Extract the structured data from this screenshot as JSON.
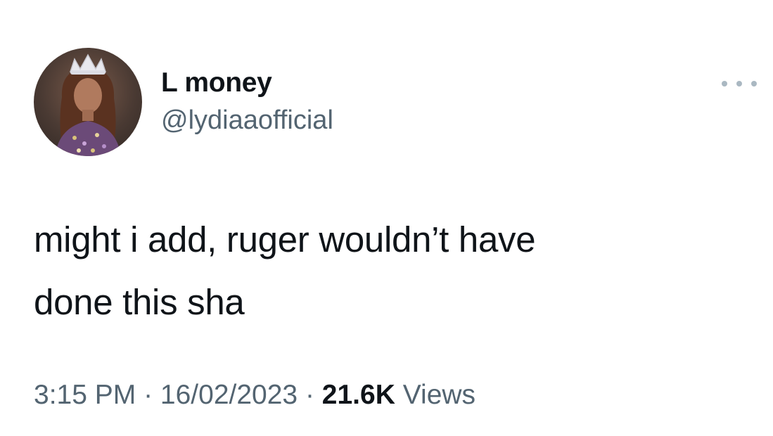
{
  "tweet": {
    "author": {
      "display_name": "L money",
      "handle": "@lydiaaofficial",
      "avatar": "profile-photo"
    },
    "more_icon": "more-horizontal-icon",
    "text_lines": [
      "might i add, ruger wouldn’t have",
      "done this sha"
    ],
    "meta": {
      "time": "3:15 PM",
      "separator": " · ",
      "date": "16/02/2023",
      "views_count": "21.6K",
      "views_label": "Views"
    }
  },
  "colors": {
    "primary_text": "#0f1419",
    "secondary_text": "#536471",
    "more_dots": "#aab8c2",
    "background": "#ffffff"
  }
}
